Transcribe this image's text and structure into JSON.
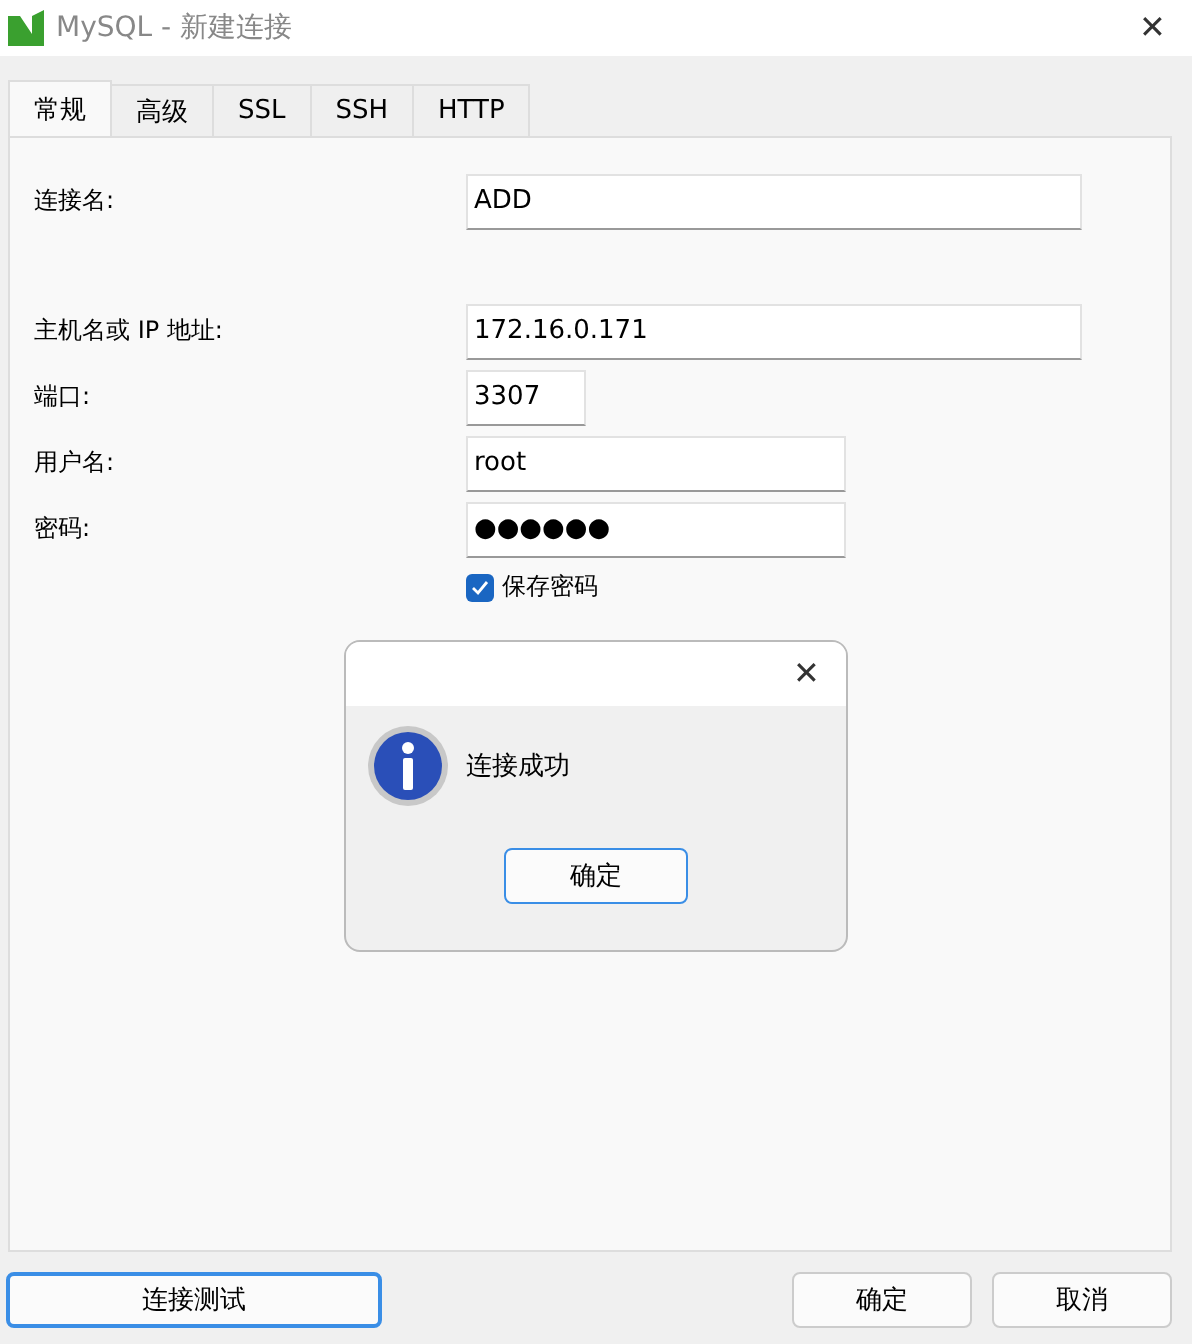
{
  "window": {
    "title": "MySQL - 新建连接",
    "close": "✕"
  },
  "tabs": [
    {
      "label": "常规",
      "selected": true
    },
    {
      "label": "高级",
      "selected": false
    },
    {
      "label": "SSL",
      "selected": false
    },
    {
      "label": "SSH",
      "selected": false
    },
    {
      "label": "HTTP",
      "selected": false
    }
  ],
  "fields": [
    {
      "label": "连接名:",
      "value": "ADD"
    },
    {
      "label": "主机名或 IP 地址:",
      "value": "172.16.0.171"
    },
    {
      "label": "端口:",
      "value": "3307"
    },
    {
      "label": "用户名:",
      "value": "root"
    },
    {
      "label": "密码:",
      "value": "●●●●●●"
    }
  ],
  "save_password": {
    "label": "保存密码",
    "checked": true
  },
  "dialog": {
    "close": "✕",
    "message": "连接成功",
    "button": "确定"
  },
  "buttons": {
    "test": "连接测试",
    "ok": "确定",
    "cancel": "取消"
  }
}
